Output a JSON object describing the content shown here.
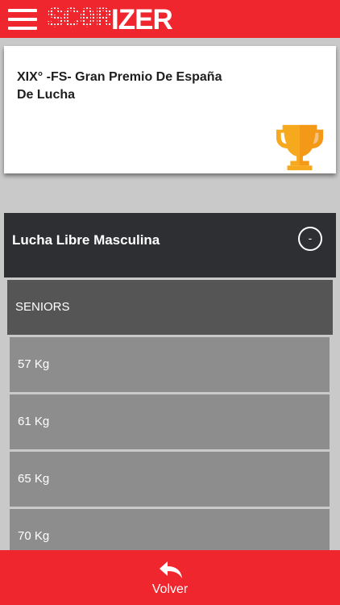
{
  "header": {
    "logo_dotted": "SC0R",
    "logo_solid": "IZER"
  },
  "event": {
    "title": "XIX° -FS- Gran Premio De España De Lucha",
    "icon": "trophy-icon"
  },
  "section": {
    "title": "Lucha Libre Masculina",
    "toggle_symbol": "-"
  },
  "category": {
    "label": "SENIORS"
  },
  "weights": [
    {
      "label": "57 Kg"
    },
    {
      "label": "61 Kg"
    },
    {
      "label": "65 Kg"
    },
    {
      "label": "70 Kg"
    }
  ],
  "footer": {
    "back_label": "Volver"
  },
  "colors": {
    "brand_red": "#f0262e",
    "section_dark": "#2e2f33",
    "category_gray": "#555555",
    "weight_gray": "#8d8d8d",
    "trophy_gold": "#f7a91d"
  }
}
